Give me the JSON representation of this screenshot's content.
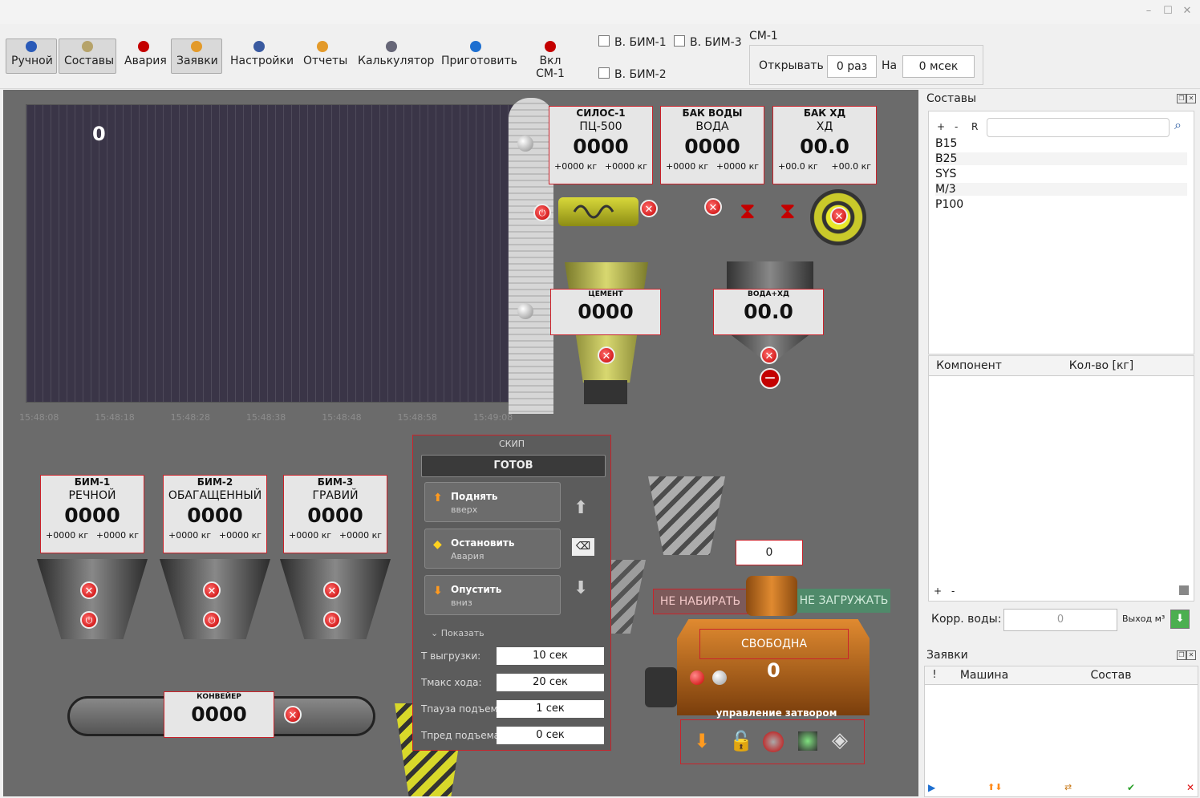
{
  "toolbar": {
    "buttons": [
      {
        "label": "Ручной",
        "icon": "pause-icon",
        "pressed": true
      },
      {
        "label": "Составы",
        "icon": "recipe-icon",
        "pressed": true
      },
      {
        "label": "Авария",
        "icon": "alarm-icon",
        "pressed": false
      },
      {
        "label": "Заявки",
        "icon": "orders-icon",
        "pressed": true
      },
      {
        "label": "Настройки",
        "icon": "settings-icon",
        "pressed": false
      },
      {
        "label": "Отчеты",
        "icon": "reports-icon",
        "pressed": false
      },
      {
        "label": "Калькулятор",
        "icon": "calculator-icon",
        "pressed": false
      },
      {
        "label": "Приготовить",
        "icon": "play-icon",
        "pressed": false
      },
      {
        "label": "Вкл СМ-1",
        "icon": "power-icon",
        "pressed": false
      }
    ],
    "checkboxes": {
      "bim1": "В. БИМ-1",
      "bim2": "В. БИМ-2",
      "bim3": "В. БИМ-3"
    },
    "cm": {
      "title": "СМ-1",
      "open_label": "Открывать",
      "open_value": "0 раз",
      "on_label": "На",
      "on_value": "0 мсек"
    }
  },
  "graph": {
    "value": "0",
    "ticks": [
      "15:48:08",
      "15:48:18",
      "15:48:28",
      "15:48:38",
      "15:48:48",
      "15:48:58",
      "15:49:08"
    ]
  },
  "silo": {
    "title": "СИЛОС-1",
    "sub": "ПЦ-500",
    "value": "0000",
    "left": "+0000 кг",
    "right": "+0000 кг"
  },
  "water": {
    "title": "БАК ВОДЫ",
    "sub": "ВОДА",
    "value": "0000",
    "left": "+0000 кг",
    "right": "+0000 кг"
  },
  "chem": {
    "title": "БАК ХД",
    "sub": "ХД",
    "value": "00.0",
    "left": "+00.0 кг",
    "right": "+00.0 кг"
  },
  "cement": {
    "title": "ЦЕМЕНТ",
    "value": "0000"
  },
  "waterchem": {
    "title": "ВОДА+ХД",
    "value": "00.0"
  },
  "bins": [
    {
      "title": "БИМ-1",
      "sub": "РЕЧНОЙ",
      "value": "0000",
      "left": "+0000 кг",
      "right": "+0000 кг"
    },
    {
      "title": "БИМ-2",
      "sub": "ОБАГАЩЕННЫЙ",
      "value": "0000",
      "left": "+0000 кг",
      "right": "+0000 кг"
    },
    {
      "title": "БИМ-3",
      "sub": "ГРАВИЙ",
      "value": "0000",
      "left": "+0000 кг",
      "right": "+0000 кг"
    }
  ],
  "conveyor": {
    "title": "КОНВЕЙЕР",
    "value": "0000"
  },
  "skip": {
    "title": "СКИП",
    "status": "ГОТОВ",
    "up": {
      "title": "Поднять",
      "sub": "вверх"
    },
    "stop": {
      "title": "Остановить",
      "sub": "Авария"
    },
    "down": {
      "title": "Опустить",
      "sub": "вниз"
    },
    "show": "Показать",
    "params": [
      {
        "label": "T выгрузки:",
        "value": "10 сек"
      },
      {
        "label": "Tмакс хода:",
        "value": "20 сек"
      },
      {
        "label": "Tпауза подъема:",
        "value": "1 сек"
      },
      {
        "label": "Tпред подъема:",
        "value": "0 сек"
      }
    ]
  },
  "mixer": {
    "counter": "0",
    "no_load_label": "НЕ НАБИРАТЬ",
    "no_unload_label": "НЕ ЗАГРУЖАТЬ",
    "status": "СВОБОДНА",
    "value": "0",
    "gate_label": "управление затвором"
  },
  "recipes": {
    "title": "Составы",
    "add": "+",
    "remove": "-",
    "refresh": "R",
    "items": [
      "B15",
      "B25",
      "SYS",
      "M/3",
      "P100"
    ],
    "columns": [
      "Компонент",
      "Кол-во [кг]"
    ],
    "add2": "+",
    "remove2": "-",
    "water_corr_label": "Корр. воды:",
    "water_corr_value": "0",
    "output_label": "Выход м³"
  },
  "orders": {
    "title": "Заявки",
    "columns": [
      "!",
      "Машина",
      "Состав"
    ]
  }
}
